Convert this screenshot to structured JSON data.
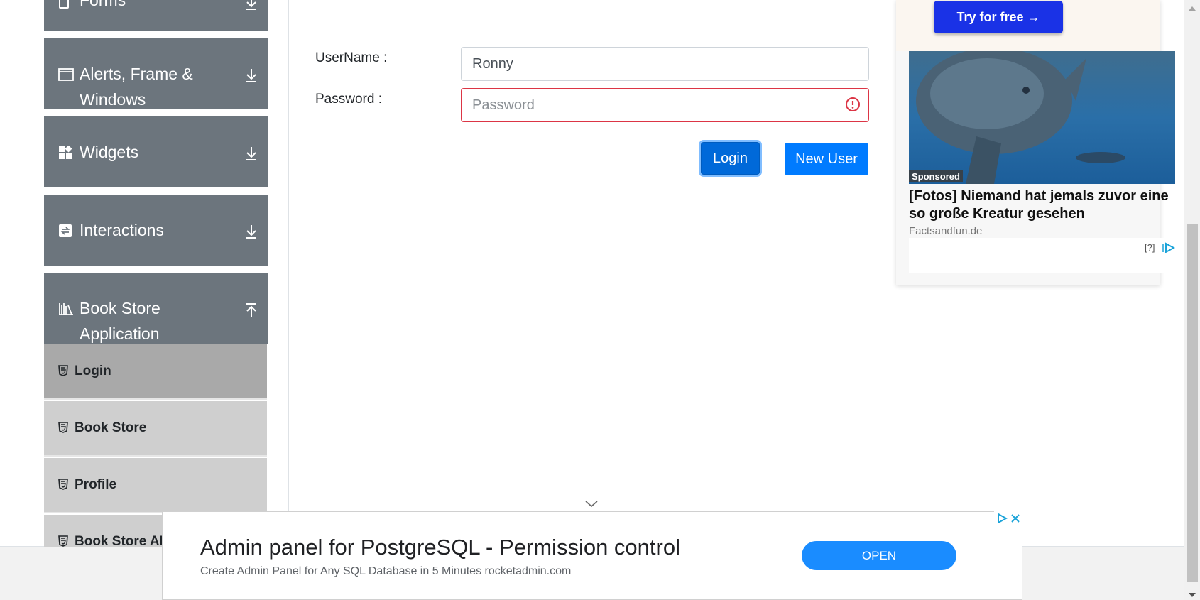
{
  "sidebar": {
    "groups": [
      {
        "label": "Forms",
        "icon": "form-icon",
        "arrow": "download-arrow-icon"
      },
      {
        "label": "Alerts, Frame & Windows",
        "icon": "window-icon",
        "arrow": "download-arrow-icon"
      },
      {
        "label": "Widgets",
        "icon": "widgets-icon",
        "arrow": "download-arrow-icon"
      },
      {
        "label": "Interactions",
        "icon": "interactions-icon",
        "arrow": "download-arrow-icon"
      },
      {
        "label": "Book Store Application",
        "icon": "books-icon",
        "arrow": "upload-arrow-icon"
      }
    ],
    "items": [
      {
        "label": "Login",
        "active": true
      },
      {
        "label": "Book Store",
        "active": false
      },
      {
        "label": "Profile",
        "active": false
      },
      {
        "label": "Book Store API",
        "active": false
      }
    ]
  },
  "form": {
    "username_label": "UserName :",
    "username_value": "Ronny",
    "password_label": "Password :",
    "password_placeholder": "Password",
    "login_button": "Login",
    "new_user_button": "New User"
  },
  "ad_right": {
    "cta": "Try for free →",
    "sponsored": "Sponsored",
    "headline": "[Fotos] Niemand hat jemals zuvor eine so große Kreatur gesehen",
    "source": "Factsandfun.de",
    "help": "[?]"
  },
  "ad_bottom": {
    "title": "Admin panel for PostgreSQL - Permission control",
    "description": "Create Admin Panel for Any SQL Database in 5 Minutes rocketadmin.com",
    "button": "OPEN"
  },
  "colors": {
    "primary": "#007bff",
    "sidebar_group": "#6c757d",
    "sub_item": "#cfcfcf",
    "sub_item_active": "#a9a9a9",
    "invalid": "#dc3545",
    "ad_cta": "#1a32e6"
  }
}
